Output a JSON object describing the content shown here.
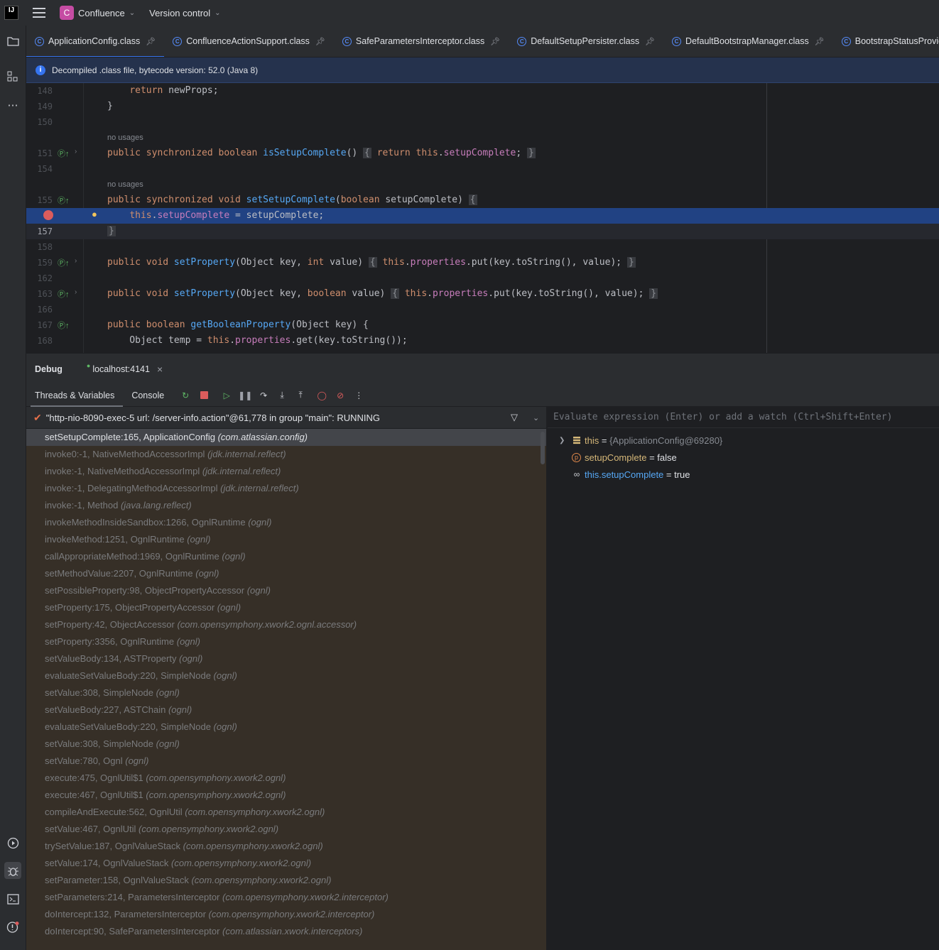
{
  "titlebar": {
    "logo": "IJ",
    "project_initial": "C",
    "project_name": "Confluence",
    "vcs_label": "Version control"
  },
  "tabs": [
    {
      "label": "ApplicationConfig.class",
      "active": true
    },
    {
      "label": "ConfluenceActionSupport.class"
    },
    {
      "label": "SafeParametersInterceptor.class"
    },
    {
      "label": "DefaultSetupPersister.class"
    },
    {
      "label": "DefaultBootstrapManager.class"
    },
    {
      "label": "BootstrapStatusProviderImpl.class"
    }
  ],
  "banner": {
    "text": "Decompiled .class file, bytecode version: 52.0 (Java 8)"
  },
  "editor": {
    "line_numbers": {
      "l148": "148",
      "l149": "149",
      "l150": "150",
      "l151": "151",
      "l154": "154",
      "l155": "155",
      "l157": "157",
      "l158": "158",
      "l159": "159",
      "l162": "162",
      "l163": "163",
      "l166": "166",
      "l167": "167",
      "l168": "168"
    },
    "usage_hint": "no usages",
    "code": {
      "return_kw": "return",
      "return_rest": " newProps;",
      "close_brace": "}",
      "l151_a": "public synchronized boolean ",
      "l151_fn": "isSetupComplete",
      "l151_b": "() ",
      "l151_open": "{",
      "l151_ret": " return ",
      "l151_this": "this",
      "l151_dot": ".",
      "l151_field": "setupComplete",
      "l151_end": "; ",
      "l151_close": "}",
      "l155_a": "public synchronized void ",
      "l155_fn": "setSetupComplete",
      "l155_b": "(",
      "l155_kw": "boolean",
      "l155_c": " setupComplete) ",
      "l155_open": "{",
      "l156_this": "this",
      "l156_dot": ".",
      "l156_field": "setupComplete",
      "l156_rest": " = setupComplete;",
      "l159_a": "public void ",
      "l159_fn": "setProperty",
      "l159_b": "(Object key, ",
      "l159_kw": "int",
      "l159_c": " value) ",
      "l159_open": "{",
      "l159_this": " this",
      "l159_dot": ".",
      "l159_field": "properties",
      "l159_rest": ".put(key.toString(), value); ",
      "l159_close": "}",
      "l163_kw": "boolean",
      "l163_c": " value) ",
      "l167_a": "public boolean ",
      "l167_fn": "getBooleanProperty",
      "l167_b": "(Object key) {",
      "l168_a": "    Object temp = ",
      "l168_this": "this",
      "l168_dot": ".",
      "l168_field": "properties",
      "l168_rest": ".get(key.toString());"
    }
  },
  "debug": {
    "title": "Debug",
    "session": "localhost:4141",
    "tabs": [
      "Threads & Variables",
      "Console"
    ],
    "thread": "\"http-nio-8090-exec-5 url: /server-info.action\"@61,778 in group \"main\": RUNNING",
    "frames": [
      {
        "m": "setSetupComplete:165, ApplicationConfig",
        "p": "(com.atlassian.config)"
      },
      {
        "m": "invoke0:-1, NativeMethodAccessorImpl",
        "p": "(jdk.internal.reflect)"
      },
      {
        "m": "invoke:-1, NativeMethodAccessorImpl",
        "p": "(jdk.internal.reflect)"
      },
      {
        "m": "invoke:-1, DelegatingMethodAccessorImpl",
        "p": "(jdk.internal.reflect)"
      },
      {
        "m": "invoke:-1, Method",
        "p": "(java.lang.reflect)"
      },
      {
        "m": "invokeMethodInsideSandbox:1266, OgnlRuntime",
        "p": "(ognl)"
      },
      {
        "m": "invokeMethod:1251, OgnlRuntime",
        "p": "(ognl)"
      },
      {
        "m": "callAppropriateMethod:1969, OgnlRuntime",
        "p": "(ognl)"
      },
      {
        "m": "setMethodValue:2207, OgnlRuntime",
        "p": "(ognl)"
      },
      {
        "m": "setPossibleProperty:98, ObjectPropertyAccessor",
        "p": "(ognl)"
      },
      {
        "m": "setProperty:175, ObjectPropertyAccessor",
        "p": "(ognl)"
      },
      {
        "m": "setProperty:42, ObjectAccessor",
        "p": "(com.opensymphony.xwork2.ognl.accessor)"
      },
      {
        "m": "setProperty:3356, OgnlRuntime",
        "p": "(ognl)"
      },
      {
        "m": "setValueBody:134, ASTProperty",
        "p": "(ognl)"
      },
      {
        "m": "evaluateSetValueBody:220, SimpleNode",
        "p": "(ognl)"
      },
      {
        "m": "setValue:308, SimpleNode",
        "p": "(ognl)"
      },
      {
        "m": "setValueBody:227, ASTChain",
        "p": "(ognl)"
      },
      {
        "m": "evaluateSetValueBody:220, SimpleNode",
        "p": "(ognl)"
      },
      {
        "m": "setValue:308, SimpleNode",
        "p": "(ognl)"
      },
      {
        "m": "setValue:780, Ognl",
        "p": "(ognl)"
      },
      {
        "m": "execute:475, OgnlUtil$1",
        "p": "(com.opensymphony.xwork2.ognl)"
      },
      {
        "m": "execute:467, OgnlUtil$1",
        "p": "(com.opensymphony.xwork2.ognl)"
      },
      {
        "m": "compileAndExecute:562, OgnlUtil",
        "p": "(com.opensymphony.xwork2.ognl)"
      },
      {
        "m": "setValue:467, OgnlUtil",
        "p": "(com.opensymphony.xwork2.ognl)"
      },
      {
        "m": "trySetValue:187, OgnlValueStack",
        "p": "(com.opensymphony.xwork2.ognl)"
      },
      {
        "m": "setValue:174, OgnlValueStack",
        "p": "(com.opensymphony.xwork2.ognl)"
      },
      {
        "m": "setParameter:158, OgnlValueStack",
        "p": "(com.opensymphony.xwork2.ognl)"
      },
      {
        "m": "setParameters:214, ParametersInterceptor",
        "p": "(com.opensymphony.xwork2.interceptor)"
      },
      {
        "m": "doIntercept:132, ParametersInterceptor",
        "p": "(com.opensymphony.xwork2.interceptor)"
      },
      {
        "m": "doIntercept:90, SafeParametersInterceptor",
        "p": "(com.atlassian.xwork.interceptors)"
      }
    ],
    "eval_placeholder": "Evaluate expression (Enter) or add a watch (Ctrl+Shift+Enter)",
    "variables": {
      "this_name": "this",
      "this_eq": " = ",
      "this_val": "{ApplicationConfig@69280}",
      "p_icon": "p",
      "p_name": "setupComplete",
      "p_eq": " = ",
      "p_val": "false",
      "w_name": "this.setupComplete",
      "w_eq": " = ",
      "w_val": "true"
    }
  },
  "colors": {
    "accent": "#3574f0",
    "frames_bg": "#362f27",
    "selection": "#214283",
    "breakpoint": "#db5c5c"
  }
}
